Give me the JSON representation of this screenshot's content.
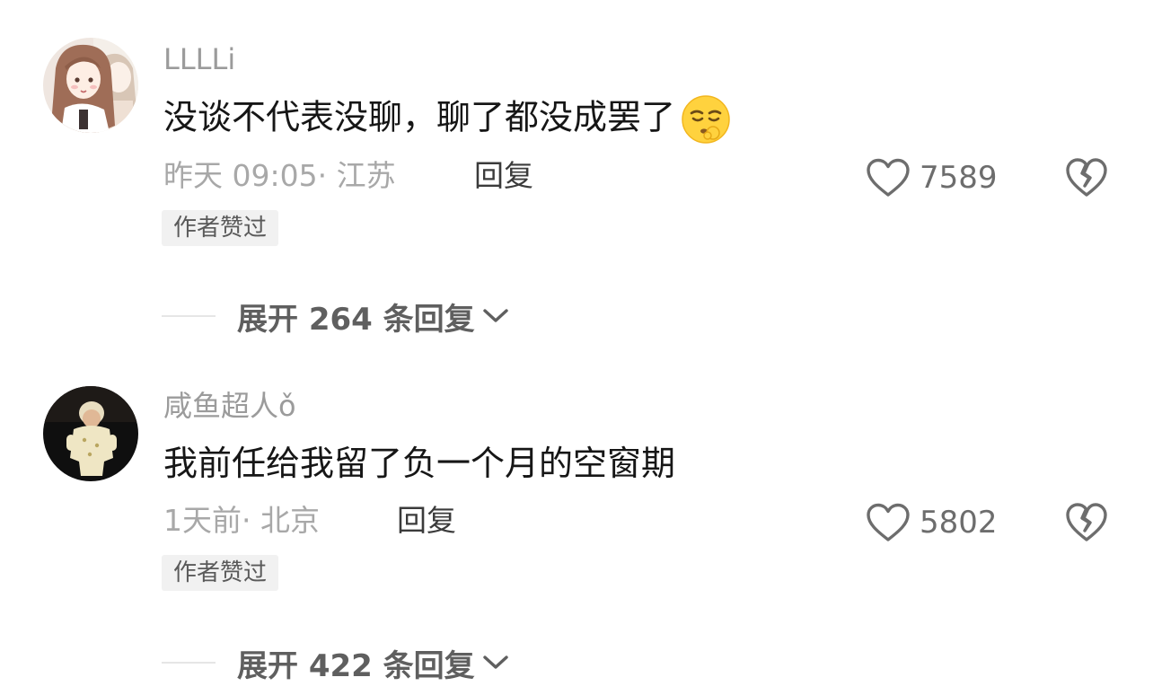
{
  "comments": [
    {
      "username": "LLLLi",
      "content": "没谈不代表没聊，聊了都没成罢了",
      "time": "昨天 09:05",
      "location": "· 江苏",
      "reply_label": "回复",
      "likes": "7589",
      "badge": "作者赞过",
      "expand_label": "展开 264 条回复",
      "emoji_icon": "shushing-face-emoji"
    },
    {
      "username": "咸鱼超人ǒ",
      "content": "我前任给我留了负一个月的空窗期",
      "time": "1天前",
      "location": "· 北京",
      "reply_label": "回复",
      "likes": "5802",
      "badge": "作者赞过",
      "expand_label": "展开 422 条回复"
    }
  ],
  "colors": {
    "meta_gray": "#a8a8a8",
    "text_dark": "#161616",
    "badge_bg": "#f1f1f1"
  }
}
